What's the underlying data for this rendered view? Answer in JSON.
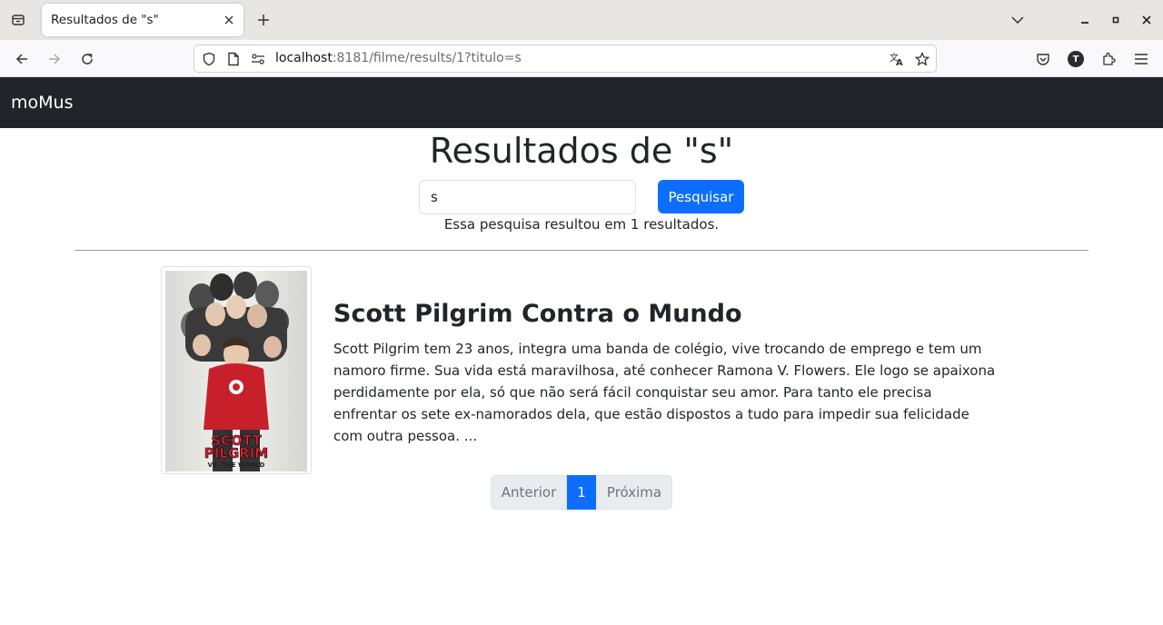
{
  "browser": {
    "tab_title": "Resultados de \"s\"",
    "url_host": "localhost",
    "url_rest": ":8181/filme/results/1?titulo=s",
    "account_initial": "T"
  },
  "site": {
    "brand": "moMus"
  },
  "search": {
    "heading": "Resultados de \"s\"",
    "query_value": "s",
    "button_label": "Pesquisar",
    "result_summary": "Essa pesquisa resultou em 1 resultados."
  },
  "results": [
    {
      "title": "Scott Pilgrim Contra o Mundo",
      "description": "Scott Pilgrim tem 23 anos, integra uma banda de colégio, vive trocando de emprego e tem um namoro firme. Sua vida está maravilhosa, até conhecer Ramona V. Flowers. Ele logo se apaixona perdidamente por ela, só que não será fácil conquistar seu amor. Para tanto ele precisa enfrentar os sete ex-namorados dela, que estão dispostos a tudo para impedir sua felicidade com outra pessoa. ...",
      "poster_text_1": "SCOTT",
      "poster_text_2": "PILGRIM",
      "poster_text_3": "VS. THE WORLD"
    }
  ],
  "pagination": {
    "prev_label": "Anterior",
    "current_page": "1",
    "next_label": "Próxima"
  },
  "colors": {
    "primary": "#0d6efd",
    "navbar": "#212529"
  }
}
